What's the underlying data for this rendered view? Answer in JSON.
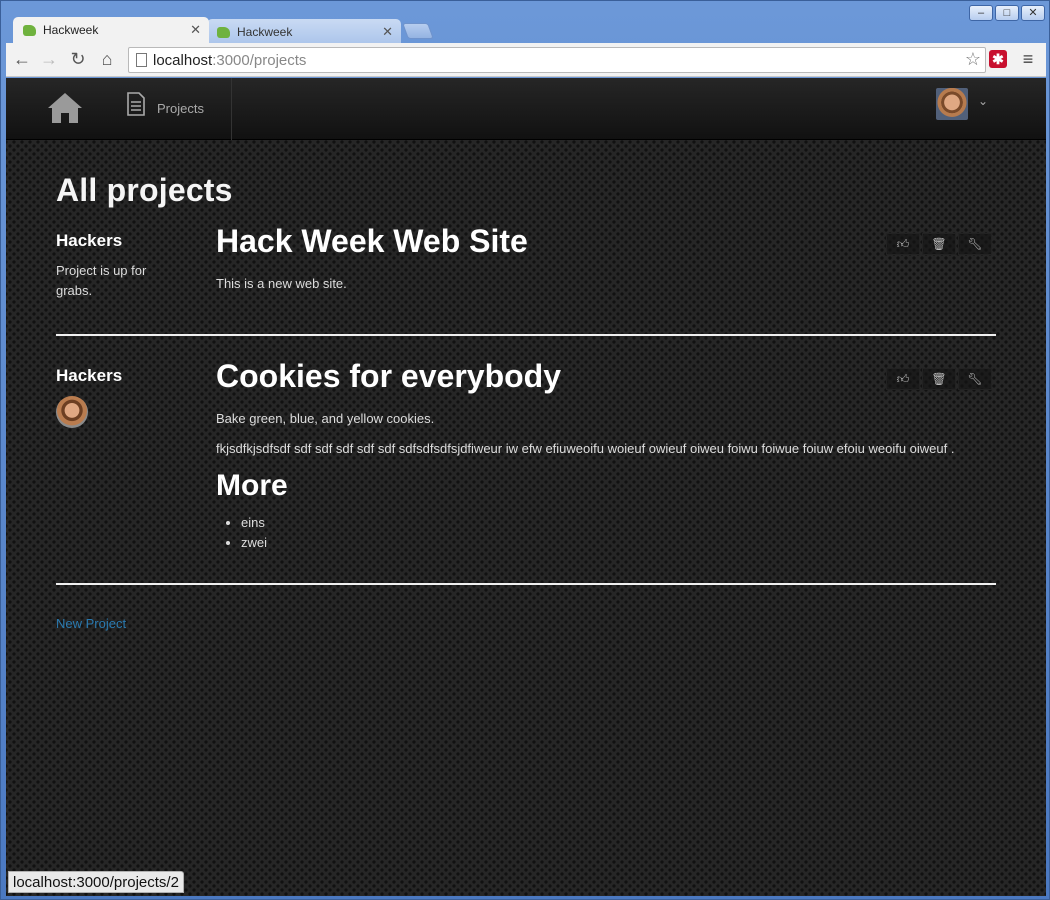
{
  "browser": {
    "tabs": [
      {
        "title": "Hackweek",
        "active": true
      },
      {
        "title": "Hackweek",
        "active": false
      }
    ],
    "url_host": "localhost",
    "url_path": ":3000/projects",
    "status_url": "localhost:3000/projects/2",
    "window_controls": {
      "minimize": "–",
      "maximize": "□",
      "close": "✕"
    }
  },
  "nav": {
    "projects_label": "Projects"
  },
  "page": {
    "title": "All projects",
    "projects": [
      {
        "team": "Hackers",
        "status": "Project is up for grabs.",
        "title": "Hack Week Web Site",
        "description": [
          "This is a new web site."
        ],
        "more_heading": "",
        "more_items": []
      },
      {
        "team": "Hackers",
        "status": "",
        "title": "Cookies for everybody",
        "description": [
          "Bake green, blue, and yellow cookies.",
          "fkjsdfkjsdfsdf sdf sdf sdf sdf sdf sdfsdfsdfsjdfiweur iw efw efiuweoifu woieuf owieuf oiweu foiwu foiwue foiuw efoiu weoifu oiweuf ."
        ],
        "more_heading": "More",
        "more_items": [
          "eins",
          "zwei"
        ]
      }
    ],
    "new_project_link": "New Project"
  },
  "icons": {
    "like": "thumbs-up-icon",
    "delete": "trash-icon",
    "edit": "wrench-icon",
    "home": "home-icon",
    "projects": "document-icon"
  },
  "colors": {
    "link": "#2a7ab0",
    "page_bg": "#262626",
    "tab_favicon": "#6fb23e"
  }
}
